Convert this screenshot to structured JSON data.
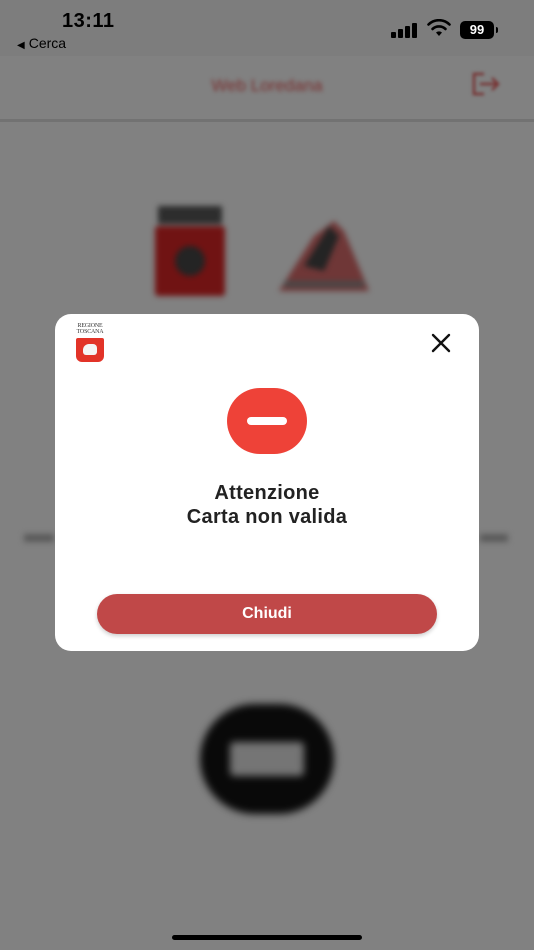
{
  "status_bar": {
    "time": "13:11",
    "back_label": "Cerca",
    "battery": "99"
  },
  "background": {
    "header_title": "Web Loredana"
  },
  "modal": {
    "brand_line1": "REGIONE",
    "brand_line2": "TOSCANA",
    "title": "Attenzione",
    "message": "Carta non valida",
    "button_label": "Chiudi",
    "status_icon": "minus-circle-icon",
    "accent_color": "#ee4238",
    "button_color": "#c04848"
  }
}
